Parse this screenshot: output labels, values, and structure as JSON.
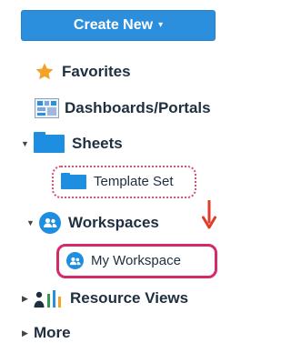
{
  "create_button": {
    "label": "Create New",
    "caret": "▾"
  },
  "nav": {
    "favorites": {
      "label": "Favorites",
      "icon": "star-icon"
    },
    "dashboards": {
      "label": "Dashboards/Portals",
      "icon": "dashboard-icon"
    },
    "sheets": {
      "label": "Sheets",
      "toggle": "▼",
      "icon": "folder-icon"
    },
    "template_set": {
      "label": "Template Set",
      "icon": "folder-icon"
    },
    "workspaces": {
      "label": "Workspaces",
      "toggle": "▼",
      "icon": "workspace-icon"
    },
    "my_workspace": {
      "label": "My Workspace",
      "icon": "workspace-icon"
    },
    "resource_views": {
      "label": "Resource Views",
      "toggle": "▶",
      "icon": "resource-views-icon"
    },
    "more": {
      "label": "More",
      "toggle": "▶"
    }
  },
  "colors": {
    "accent": "#2c8fde",
    "folder": "#1e8ee0",
    "highlight": "#d42a6a",
    "arrow": "#e03c2a",
    "star": "#f3a329"
  }
}
